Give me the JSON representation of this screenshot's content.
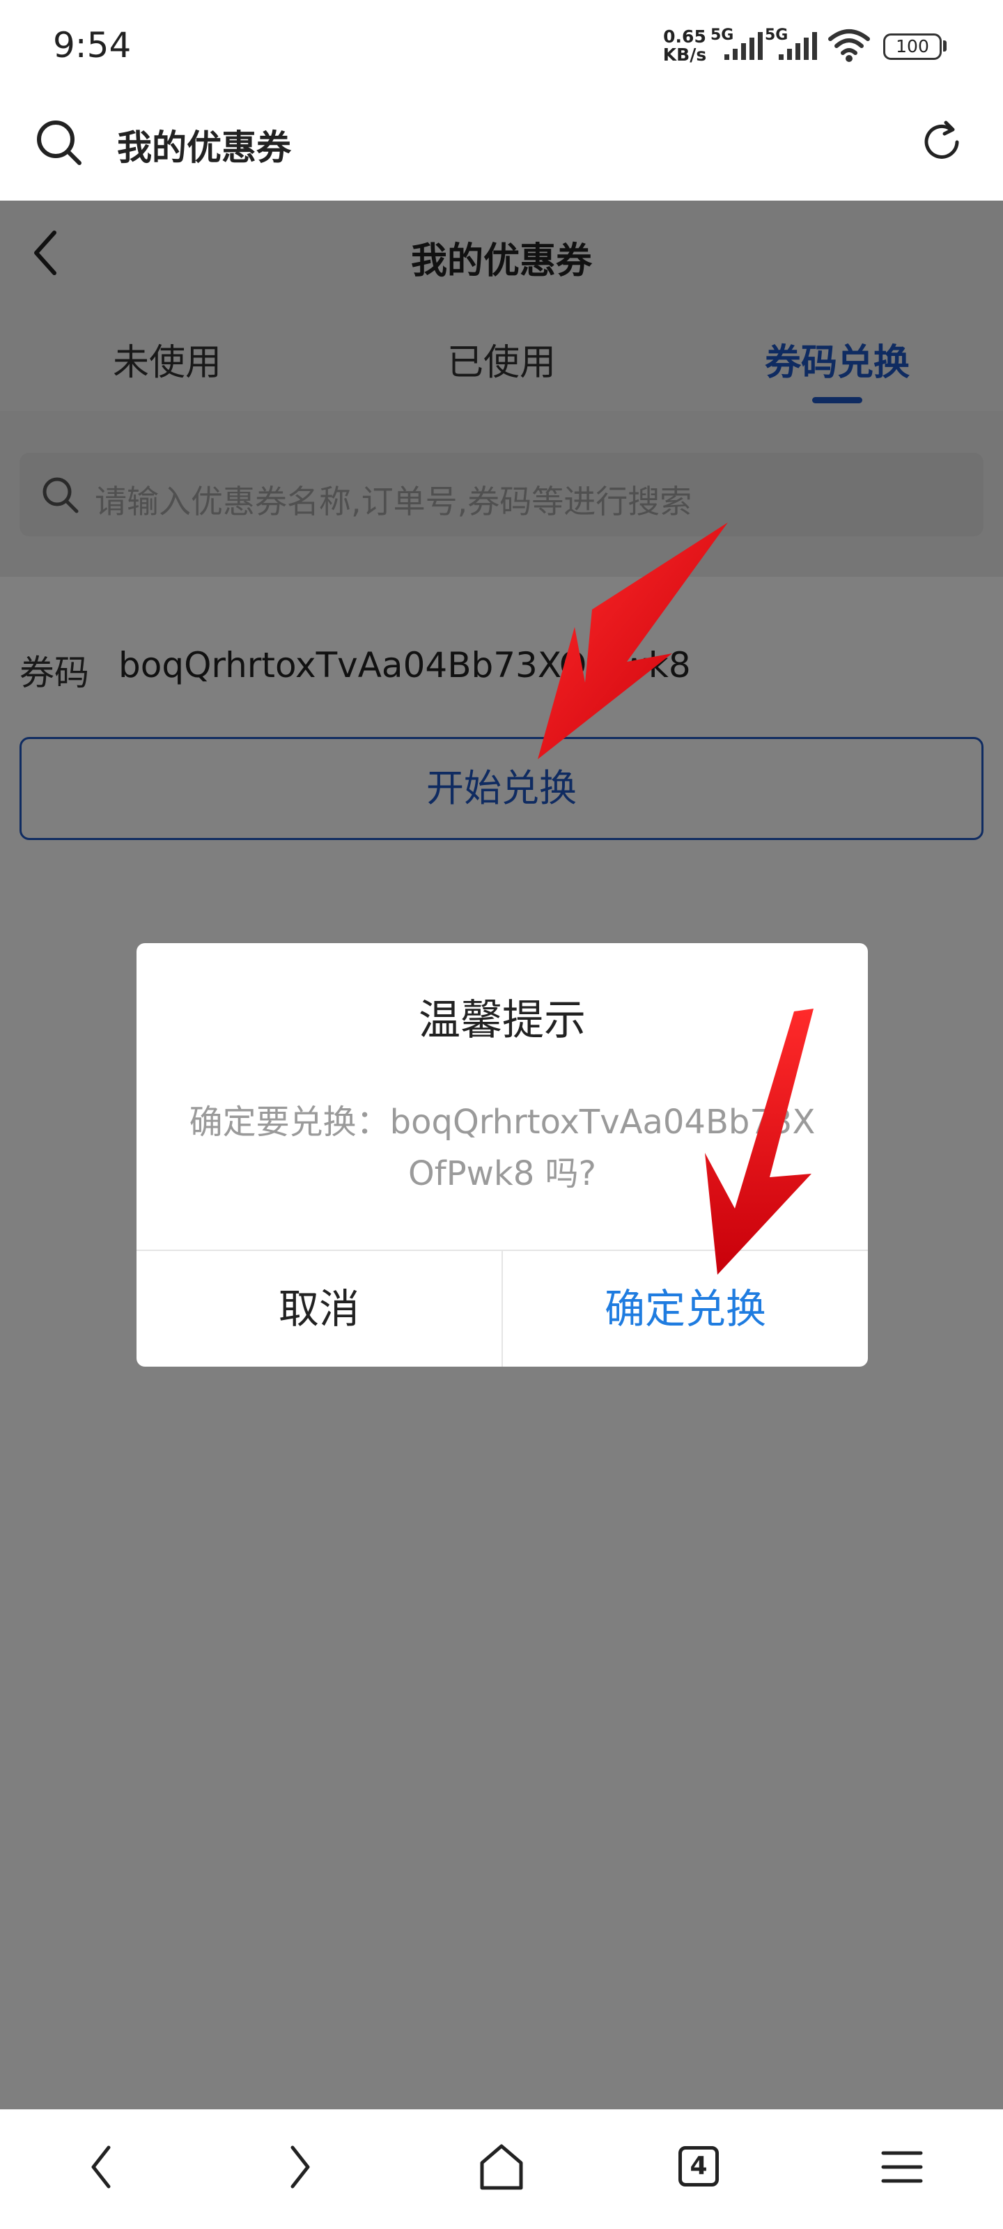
{
  "status_bar": {
    "time": "9:54",
    "net_speed_value": "0.65",
    "net_speed_unit": "KB/s",
    "signal_1": "5G",
    "signal_2": "5G",
    "battery": "100"
  },
  "browser": {
    "title": "我的优惠券"
  },
  "page": {
    "title": "我的优惠券",
    "tabs": [
      {
        "label": "未使用",
        "active": false
      },
      {
        "label": "已使用",
        "active": false
      },
      {
        "label": "券码兑换",
        "active": true
      }
    ],
    "search_placeholder": "请输入优惠券名称,订单号,券码等进行搜索",
    "code_label": "券码",
    "code_value": "boqQrhrtoxTvAa04Bb73XOfPwk8",
    "redeem_button": "开始兑换"
  },
  "dialog": {
    "title": "温馨提示",
    "message": "确定要兑换：boqQrhrtoxTvAa04Bb73XOfPwk8 吗?",
    "cancel": "取消",
    "confirm": "确定兑换"
  },
  "bottom_nav": {
    "tab_count": "4"
  },
  "colors": {
    "accent": "#1f57c3",
    "confirm": "#1f7ce0",
    "annotation_arrow": "#e8141b"
  }
}
